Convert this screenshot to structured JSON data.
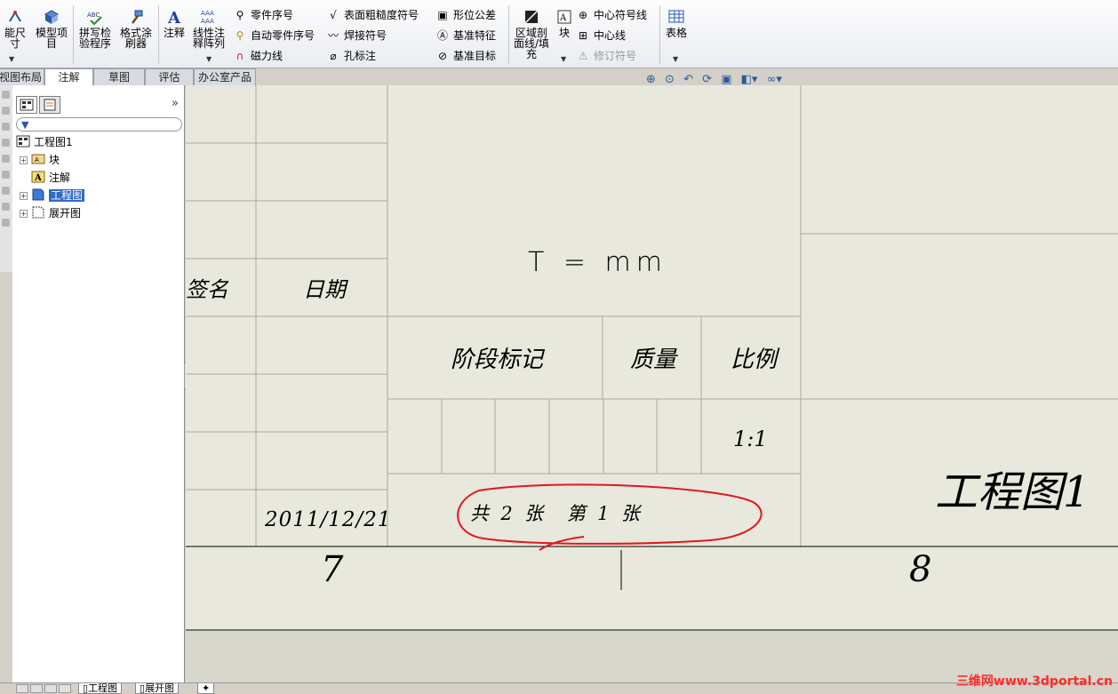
{
  "toolbar": {
    "smart_dimension": "能尺\n寸",
    "model_items": "模型项\n目",
    "spell_checker": "拼写检\n验程序",
    "format_painter": "格式涂\n刷器",
    "note": "注释",
    "linear_note_pattern": "线性注\n释阵列",
    "balloon": "零件序号",
    "auto_balloon": "自动零件序号",
    "magnetic_line": "磁力线",
    "surface_finish": "表面粗糙度符号",
    "weld_symbol": "焊接符号",
    "hole_callout": "孔标注",
    "geometric_tolerance": "形位公差",
    "datum_feature": "基准特征",
    "datum_target": "基准目标",
    "area_hatch": "区域剖\n面线/填\n充",
    "block": "块",
    "center_mark": "中心符号线",
    "centerline": "中心线",
    "revision_symbol": "修订符号",
    "table": "表格"
  },
  "tabs": [
    "视图布局",
    "注解",
    "草图",
    "评估",
    "办公室产品"
  ],
  "active_tab": "注解",
  "feature_tree": {
    "root": "工程图1",
    "items": [
      {
        "label": "块",
        "icon": "block-icon",
        "expandable": true
      },
      {
        "label": "注解",
        "icon": "annotation-icon",
        "expandable": false
      },
      {
        "label": "工程图",
        "icon": "sheet-icon",
        "expandable": true,
        "selected": true
      },
      {
        "label": "展开图",
        "icon": "flat-pattern-icon",
        "expandable": true
      }
    ]
  },
  "sheet_tabs": [
    "工程图",
    "展开图"
  ],
  "title_block": {
    "signature_label": "签名",
    "date_label": "日期",
    "material_field": "T = mm",
    "stage_mark_label": "阶段标记",
    "mass_label": "质量",
    "scale_label": "比例",
    "scale_value": "1:1",
    "date_value": "2011/12/21",
    "sheet_count": "共  2  张    第  1  张",
    "drawing_name": "工程图1",
    "zone_left": "7",
    "zone_right": "8"
  },
  "annotation_color": "#e0191f",
  "watermark": "三维网www.3dportal.cn"
}
